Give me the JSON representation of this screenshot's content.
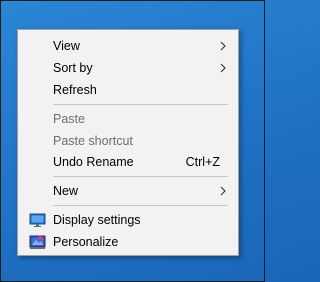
{
  "context_menu": {
    "view": {
      "label": "View"
    },
    "sort_by": {
      "label": "Sort by"
    },
    "refresh": {
      "label": "Refresh"
    },
    "paste": {
      "label": "Paste"
    },
    "paste_shortcut": {
      "label": "Paste shortcut"
    },
    "undo_rename": {
      "label": "Undo Rename",
      "shortcut": "Ctrl+Z"
    },
    "new": {
      "label": "New"
    },
    "display_settings": {
      "label": "Display settings",
      "icon": "display-icon"
    },
    "personalize": {
      "label": "Personalize",
      "icon": "personalize-icon"
    }
  },
  "colors": {
    "desktop": "#1f72c4",
    "menu_bg": "#f2f2f2",
    "disabled_text": "#6d6d6d"
  }
}
